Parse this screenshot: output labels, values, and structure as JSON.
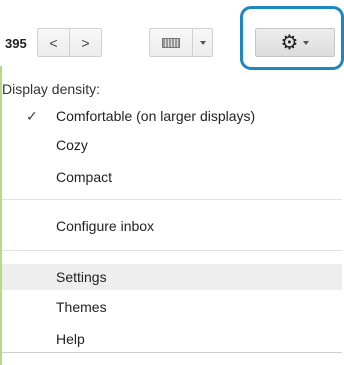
{
  "toolbar": {
    "count_text": "395",
    "prev_label": "<",
    "next_label": ">",
    "prev_icon": "chevron-left-icon",
    "next_icon": "chevron-right-icon",
    "input_tools_icon": "keyboard-icon",
    "settings_icon": "gear-icon",
    "highlight_color": "#1f86bf"
  },
  "menu": {
    "heading": "Display density:",
    "density_options": [
      {
        "label": "Comfortable (on larger displays)",
        "checked": true
      },
      {
        "label": "Cozy",
        "checked": false
      },
      {
        "label": "Compact",
        "checked": false
      }
    ],
    "check_glyph": "✓",
    "configure_inbox": "Configure inbox",
    "settings": "Settings",
    "themes": "Themes",
    "help": "Help"
  }
}
